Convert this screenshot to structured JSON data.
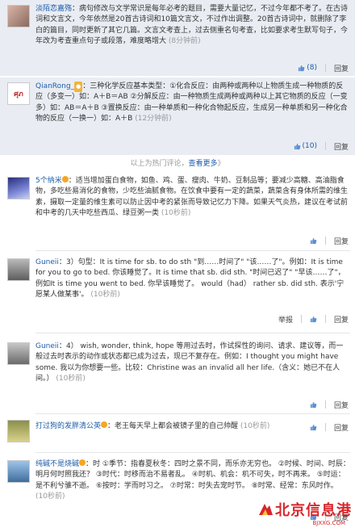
{
  "comments": [
    {
      "user": "淡陌恋嘉殇",
      "text": "病句修改与文学常识是每年必考的题目，需要大量记忆，不过今年都不考了。在古诗词和文言文，今年依然是20首古诗词和10篇文言文，不过作出调整。20首古诗词中，就删除了李白的篇目，同时更新了其它几篇。文言文考查上，过去侧重名句考查，比如要求考生默写句子，今年改为考查重点句子或段落，难度略增大",
      "time": "(8分钟前)",
      "likes": "(8)",
      "reply": "回复"
    },
    {
      "user": "QianRong_",
      "text": "三种化学反应基本类型：①化合反应：由两种或两种以上物质生成一种物质的反应（多变一）如：A＋B＝AB ②分解反应：由一种物质生成两种或两种以上其它物质的反应（一变多）如：AB＝A＋B ③置换反应：由一种单质和一种化合物起反应，生成另一种单质和另一种化合物的反应（一换一）如：A＋B",
      "time": "(12分钟前)",
      "likes": "(10)",
      "reply": "回复"
    },
    {
      "user": "5个纳米",
      "text": "适当增加蛋白食物，如鱼、鸡、蛋、瘦肉、牛奶、豆制品等；要减少高糖、高油脂食物，多吃些易消化的食物，少吃些油腻食物。在饮食中要有一定的蔬菜，蔬菜含有身体所需的维生素，摄取一定量的维生素可以防止因中考的紧张而导致记忆力下降。如果天气炎热，建议在考试前和中考的几天中吃些西瓜、绿豆粥一类",
      "time": "(10秒前)",
      "likes": "",
      "reply": "回复"
    },
    {
      "user": "Guneii",
      "text": "3）句型：It is time for sb. to do sth \"到……时间了\" \"该……了\"。例如：It is time for you to go to bed. 你该睡觉了。It is time that sb. did sth. \"时间已迟了\" \"早该……了\"，例如It is time you went to bed. 你早该睡觉了。 would（had） rather sb. did sth. 表示'宁愿某人做某事'。",
      "time": "(10秒前)",
      "report": "举报",
      "reply": "回复"
    },
    {
      "user": "Guneii",
      "text": "4） wish, wonder, think, hope 等用过去时，作试探性的询问、请求、建议等，而一般过去时表示的动作或状态都已成为过去，现已不复存在。例如：I thought you might have some. 我以为你想要一些。比较：Christine was an invalid all her life.（含义：她已不在人间。）",
      "time": "(10秒前)",
      "reply": "回复"
    },
    {
      "user": "打过狗的发胖清公英",
      "text": "老王每天早上都会被镜子里的自己帅醒",
      "time": "(10秒前)",
      "reply": "回复"
    },
    {
      "user": "纯碱不是烧碱",
      "text": "时 ①季节：指春夏秋冬：四时之景不同，而乐亦无穷也。 ②时候、时间、时辰：明月何时照我还？ ③时代：时移而治不易者乱。 ④时机、机会：机不可失，时不再来。 ⑤时运：是不利兮骓不逝。 ⑥按时：学而时习之。 ⑦时常：时失去宠时节。 ⑧时常、经常：东风时作。",
      "time": "(10秒前)",
      "reply": "回复"
    }
  ],
  "more_bar": {
    "prefix": "以上为热门评论，",
    "link": "查看更多",
    "suffix": "》"
  },
  "watermark": {
    "text": "北京信息港",
    "url": "BJXXG.COM"
  },
  "colors": {
    "link": "#1c5ca8",
    "shaded_bg": "#e9edf3",
    "watermark": "#d8262b"
  }
}
